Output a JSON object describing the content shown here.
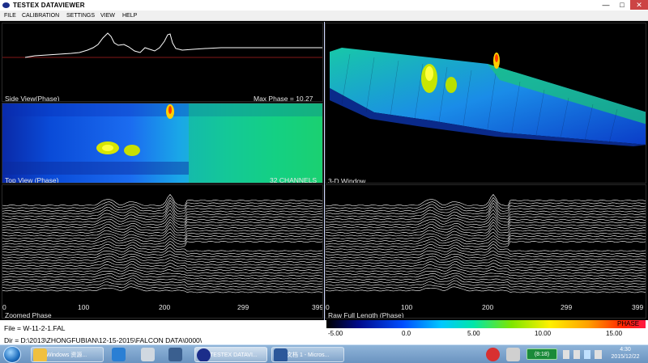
{
  "window": {
    "title": "TESTEX DATAVIEWER",
    "controls": {
      "minimize": "—",
      "maximize": "□",
      "close": "✕"
    }
  },
  "menu": [
    "FILE",
    "CALIBRATION",
    "SETTINGS",
    "VIEW",
    "HELP"
  ],
  "panels": {
    "side_view": {
      "label": "Side View(Phase)",
      "max_phase": "Max Phase = 10.27"
    },
    "top_view": {
      "label": "Top View (Phase)",
      "channels": "32 CHANNELS"
    },
    "three_d": {
      "label": "3-D Window"
    },
    "zoomed": {
      "label": "Zoomed Phase",
      "ticks": [
        "0",
        "100",
        "200",
        "299",
        "399"
      ]
    },
    "raw": {
      "label": "Raw Full Length (Phase)",
      "ticks": [
        "0",
        "100",
        "200",
        "299",
        "399"
      ]
    }
  },
  "info": {
    "file": "File = W-11-2-1.FAL",
    "dir": "Dir = D:\\2013\\ZHONGFUBIAN\\12-15-2015\\FALCON DATA\\0000\\"
  },
  "colorbar": {
    "title": "PHASE",
    "ticks": [
      "-5.00",
      "0.0",
      "5.00",
      "10.00",
      "15.00"
    ]
  },
  "taskbar": {
    "items": [
      {
        "label": "Windows 资源..."
      },
      {
        "label": "TESTEX DATAVI..."
      },
      {
        "label": "文档 1 - Micros..."
      }
    ],
    "tray": {
      "battery": "(8:18)"
    },
    "clock": {
      "time": "4:30",
      "date": "2015/12/22"
    }
  },
  "colors": {
    "accent": "#1b2d8a",
    "grid_line": "#ffffff",
    "threshold_line": "#b02020"
  }
}
